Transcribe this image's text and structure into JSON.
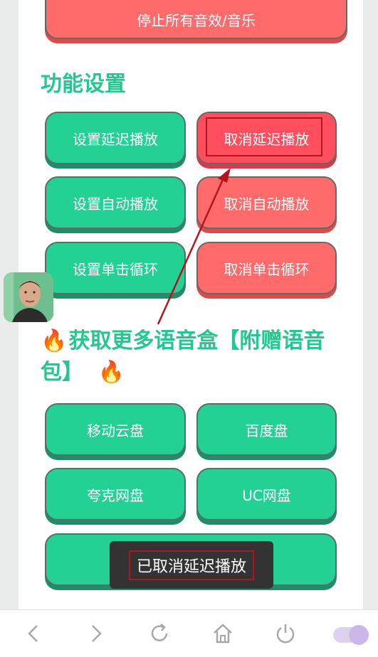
{
  "top_button": {
    "label": "停止所有音效/音乐"
  },
  "function_settings": {
    "title": "功能设置",
    "buttons": [
      {
        "label": "设置延迟播放"
      },
      {
        "label": "取消延迟播放"
      },
      {
        "label": "设置自动播放"
      },
      {
        "label": "取消自动播放"
      },
      {
        "label": "设置单击循环"
      },
      {
        "label": "取消单击循环"
      }
    ]
  },
  "voice_box": {
    "title_line1": "获取更多语音盒【附赠语音",
    "title_line2": "包】",
    "buttons": [
      {
        "label": "移动云盘"
      },
      {
        "label": "百度盘"
      },
      {
        "label": "夸克网盘"
      },
      {
        "label": "UC网盘"
      },
      {
        "label": ""
      }
    ]
  },
  "toast": {
    "message": "已取消延迟播放"
  },
  "nav": {
    "icons": [
      "back-icon",
      "forward-icon",
      "refresh-icon",
      "home-icon",
      "power-icon",
      "toggle-switch"
    ]
  },
  "colors": {
    "accent_green": "#24d195",
    "cancel_red": "#ff6a6a",
    "annotation_red": "#b5141c",
    "toggle_purple": "#cbb8e8"
  }
}
